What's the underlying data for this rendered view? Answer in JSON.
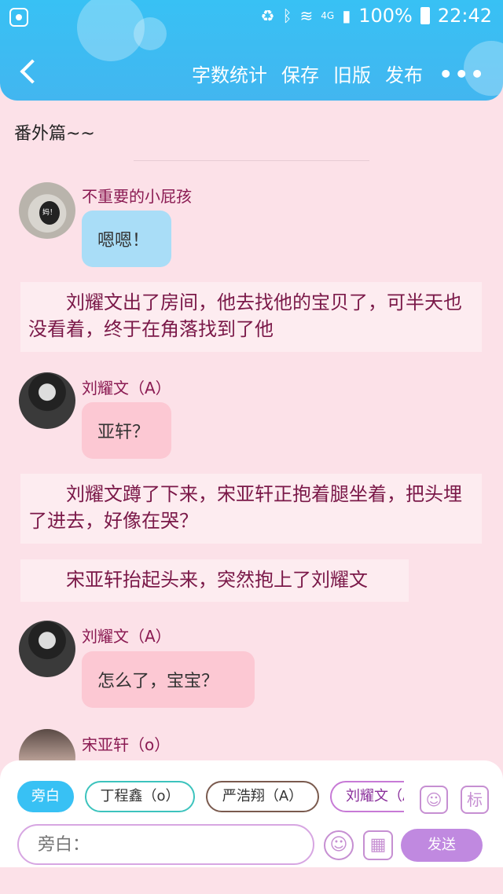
{
  "status_bar": {
    "battery": "100%",
    "time": "22:42",
    "network": "4G"
  },
  "toolbar": {
    "actions": [
      "字数统计",
      "保存",
      "旧版",
      "发布"
    ]
  },
  "chapter": {
    "title": "番外篇~~"
  },
  "messages": [
    {
      "type": "chat",
      "name": "不重要的小屁孩",
      "text": "嗯嗯！",
      "avatar_text": "妈！"
    },
    {
      "type": "narration",
      "text": "刘耀文出了房间，他去找他的宝贝了，可半天也没看着，终于在角落找到了他"
    },
    {
      "type": "chat",
      "name": "刘耀文（A）",
      "text": "亚轩？"
    },
    {
      "type": "narration",
      "text": "刘耀文蹲了下来，宋亚轩正抱着腿坐着，把头埋了进去，好像在哭？"
    },
    {
      "type": "narration",
      "text": "宋亚轩抬起头来，突然抱上了刘耀文"
    },
    {
      "type": "chat",
      "name": "刘耀文（A）",
      "text": "怎么了，宝宝？"
    },
    {
      "type": "chat",
      "name": "宋亚轩（o）",
      "text": ""
    }
  ],
  "input_panel": {
    "chips": [
      "旁白",
      "丁程鑫（o）",
      "严浩翔（A）",
      "刘耀文（A）"
    ],
    "label_button": "标",
    "input_placeholder": "旁白：",
    "send_label": "发送"
  },
  "colors": {
    "header": "#38c1f4",
    "background": "#fce1e8",
    "name_text": "#8a1a52",
    "accent_purple": "#c089e0"
  }
}
